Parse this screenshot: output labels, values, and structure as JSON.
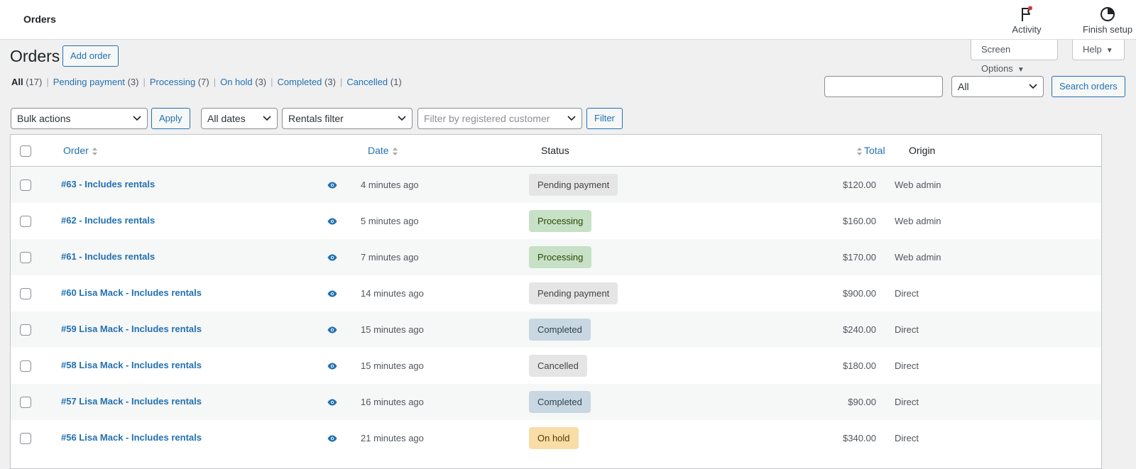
{
  "topbar": {
    "page_label": "Orders",
    "activity_label": "Activity",
    "finish_setup_label": "Finish setup"
  },
  "screen_options": {
    "screen_options_label": "Screen Options",
    "help_label": "Help"
  },
  "header": {
    "title": "Orders",
    "add_order_label": "Add order"
  },
  "status_filters": [
    {
      "label": "All",
      "count": "(17)"
    },
    {
      "label": "Pending payment",
      "count": "(3)"
    },
    {
      "label": "Processing",
      "count": "(7)"
    },
    {
      "label": "On hold",
      "count": "(3)"
    },
    {
      "label": "Completed",
      "count": "(3)"
    },
    {
      "label": "Cancelled",
      "count": "(1)"
    }
  ],
  "search": {
    "value": "",
    "status_select": "All",
    "button_label": "Search orders"
  },
  "tablenav": {
    "bulk_actions": "Bulk actions",
    "apply_label": "Apply",
    "dates": "All dates",
    "rentals_filter": "Rentals filter",
    "customer_placeholder": "Filter by registered customer",
    "filter_label": "Filter"
  },
  "table": {
    "columns": {
      "order": "Order",
      "date": "Date",
      "status": "Status",
      "total": "Total",
      "origin": "Origin"
    },
    "rows": [
      {
        "order": "#63 - Includes rentals",
        "date": "4 minutes ago",
        "status": "Pending payment",
        "total": "$120.00",
        "origin": "Web admin"
      },
      {
        "order": "#62 - Includes rentals",
        "date": "5 minutes ago",
        "status": "Processing",
        "total": "$160.00",
        "origin": "Web admin"
      },
      {
        "order": "#61 - Includes rentals",
        "date": "7 minutes ago",
        "status": "Processing",
        "total": "$170.00",
        "origin": "Web admin"
      },
      {
        "order": "#60 Lisa Mack - Includes rentals",
        "date": "14 minutes ago",
        "status": "Pending payment",
        "total": "$900.00",
        "origin": "Direct"
      },
      {
        "order": "#59 Lisa Mack - Includes rentals",
        "date": "15 minutes ago",
        "status": "Completed",
        "total": "$240.00",
        "origin": "Direct"
      },
      {
        "order": "#58 Lisa Mack - Includes rentals",
        "date": "15 minutes ago",
        "status": "Cancelled",
        "total": "$180.00",
        "origin": "Direct"
      },
      {
        "order": "#57 Lisa Mack - Includes rentals",
        "date": "16 minutes ago",
        "status": "Completed",
        "total": "$90.00",
        "origin": "Direct"
      },
      {
        "order": "#56 Lisa Mack - Includes rentals",
        "date": "21 minutes ago",
        "status": "On hold",
        "total": "$340.00",
        "origin": "Direct"
      }
    ]
  },
  "status_colors": {
    "Pending payment": {
      "bg": "#e5e5e5",
      "fg": "#454545"
    },
    "Processing": {
      "bg": "#c6e1c6",
      "fg": "#2c4700"
    },
    "Completed": {
      "bg": "#c8d7e1",
      "fg": "#2e4453"
    },
    "Cancelled": {
      "bg": "#e5e5e5",
      "fg": "#454545"
    },
    "On hold": {
      "bg": "#f8dda7",
      "fg": "#573b00"
    }
  },
  "icons": {
    "activity": "flag-icon",
    "finish_setup": "progress-circle-icon",
    "preview": "eye-icon",
    "sort": "sort-arrows-icon",
    "dropdown": "chevron-down-icon"
  },
  "accent_color": "#2271b1"
}
